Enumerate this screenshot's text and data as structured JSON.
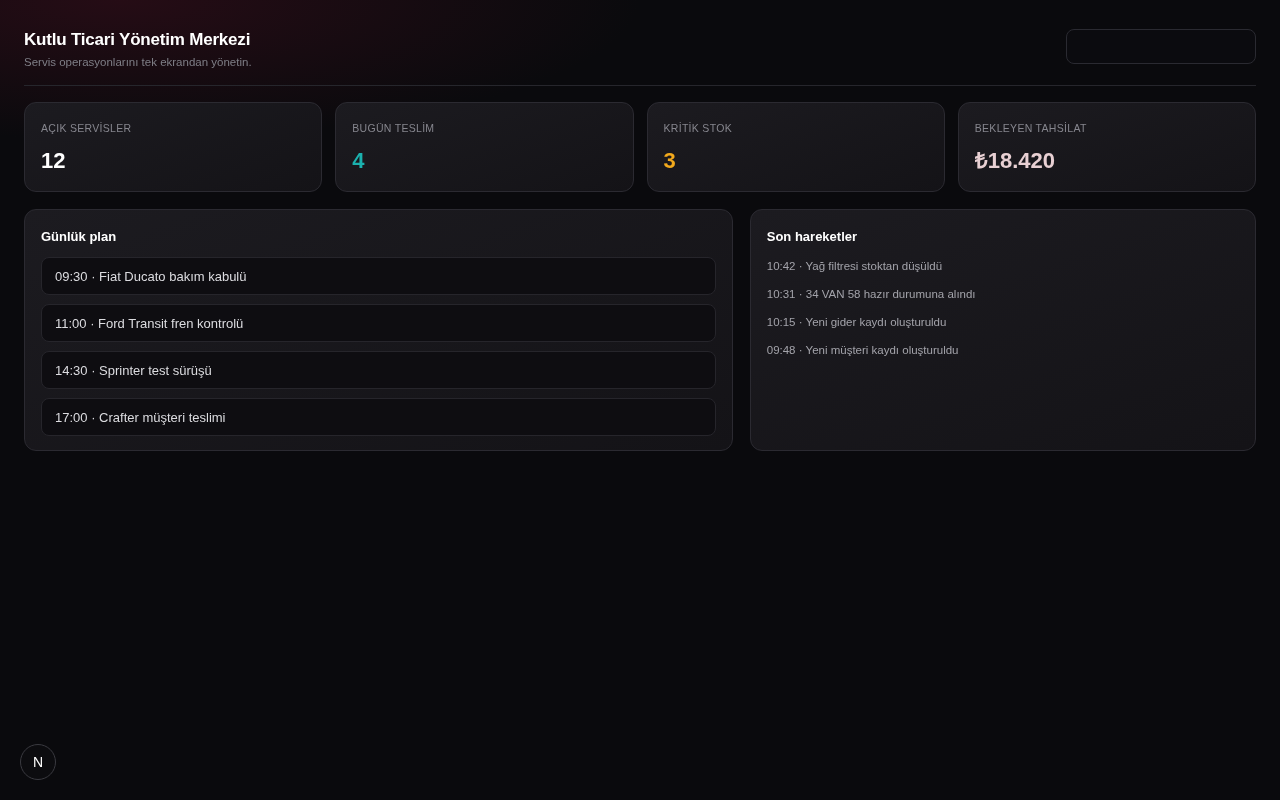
{
  "header": {
    "title": "Kutlu Ticari Yönetim Merkezi",
    "subtitle": "Servis operasyonlarını tek ekrandan yönetin."
  },
  "stats": [
    {
      "label": "AÇIK SERVİSLER",
      "value": "12",
      "color": "#ffffff"
    },
    {
      "label": "BUGÜN TESLİM",
      "value": "4",
      "color": "#1bb1ae"
    },
    {
      "label": "KRİTİK STOK",
      "value": "3",
      "color": "#f2a91c"
    },
    {
      "label": "BEKLEYEN TAHSİLAT",
      "value": "₺18.420",
      "color": "#e8d0d3"
    }
  ],
  "plan": {
    "title": "Günlük plan",
    "items": [
      "09:30 · Fiat Ducato bakım kabulü",
      "11:00 · Ford Transit fren kontrolü",
      "14:30 · Sprinter test sürüşü",
      "17:00 · Crafter müşteri teslimi"
    ]
  },
  "activity": {
    "title": "Son hareketler",
    "items": [
      "10:42 · Yağ filtresi stoktan düşüldü",
      "10:31 · 34 VAN 58 hazır durumuna alındı",
      "10:15 · Yeni gider kaydı oluşturuldu",
      "09:48 · Yeni müşteri kaydı oluşturuldu"
    ]
  },
  "dev_badge": {
    "label": "N"
  }
}
